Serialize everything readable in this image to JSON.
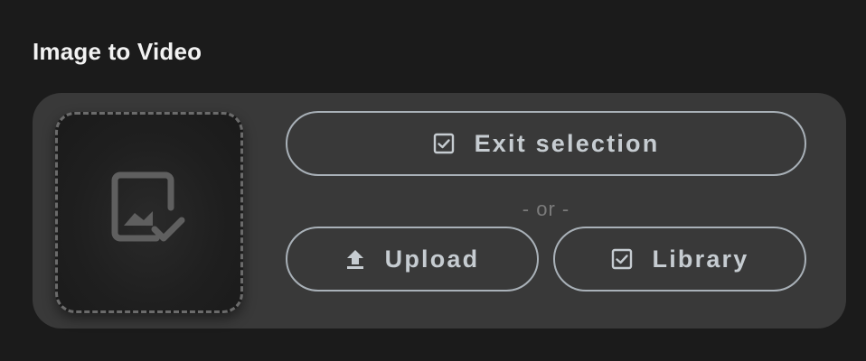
{
  "page": {
    "title": "Image to Video"
  },
  "actions": {
    "exit_selection_label": "Exit selection",
    "or_separator": "- or -",
    "upload_label": "Upload",
    "library_label": "Library"
  },
  "icons": {
    "dropzone": "image-check-icon",
    "exit_selection": "checkbox-checked-icon",
    "upload": "upload-arrow-icon",
    "library": "checkbox-checked-icon"
  },
  "colors": {
    "background": "#1b1b1b",
    "panel": "#393939",
    "pill_border": "#a9b1b8",
    "pill_text": "#c6ccd1",
    "muted_text": "#7b7b7b"
  }
}
